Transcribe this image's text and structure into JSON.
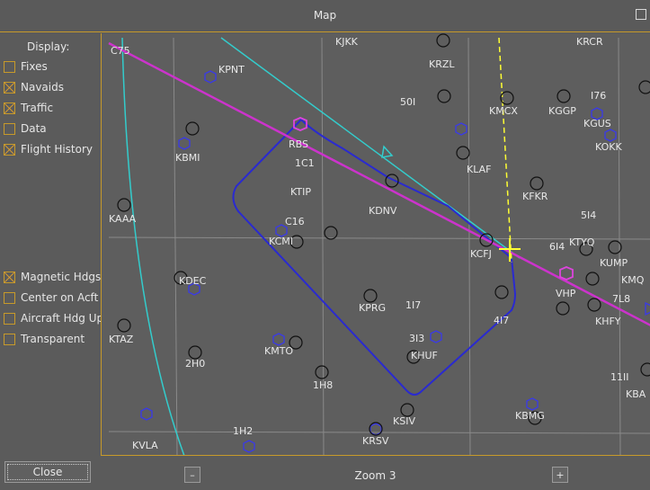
{
  "window": {
    "title": "Map"
  },
  "panel": {
    "display_label": "Display:",
    "options": [
      {
        "label": "Fixes",
        "checked": false
      },
      {
        "label": "Navaids",
        "checked": true
      },
      {
        "label": "Traffic",
        "checked": true
      },
      {
        "label": "Data",
        "checked": false
      },
      {
        "label": "Flight History",
        "checked": true
      },
      {
        "label": "Magnetic Hdgs",
        "checked": true
      },
      {
        "label": "Center on Acft",
        "checked": false
      },
      {
        "label": "Aircraft Hdg Up",
        "checked": false
      },
      {
        "label": "Transparent",
        "checked": false
      }
    ],
    "close_label": "Close"
  },
  "zoom": {
    "label": "Zoom 3",
    "minus": "–",
    "plus": "+"
  },
  "colors": {
    "accent": "#c79a2a",
    "route": "#cc33cc",
    "history": "#2a2ad0",
    "range_arc": "#33cccc",
    "traffic": "#ffff33"
  },
  "airports": [
    "KJKK",
    "KRCR",
    "C75",
    "KPNT",
    "KRZL",
    "50I",
    "KMCX",
    "KGGP",
    "I76",
    "KGUS",
    "RBS",
    "KBMI",
    "1C1",
    "KOKK",
    "KLAF",
    "KTIP",
    "KFKR",
    "KDNV",
    "C16",
    "5I4",
    "KAAA",
    "KCMI",
    "KTYQ",
    "6I4",
    "KCFJ",
    "KUMP",
    "KMQ",
    "KDEC",
    "VHP",
    "7L8",
    "KPRG",
    "1I7",
    "4I7",
    "KHFY",
    "KTAZ",
    "3I3",
    "KMTO",
    "2H0",
    "KHUF",
    "1H8",
    "11II",
    "KBA",
    "KSIV",
    "KBMG",
    "1H2",
    "KVLA",
    "KRSV"
  ]
}
